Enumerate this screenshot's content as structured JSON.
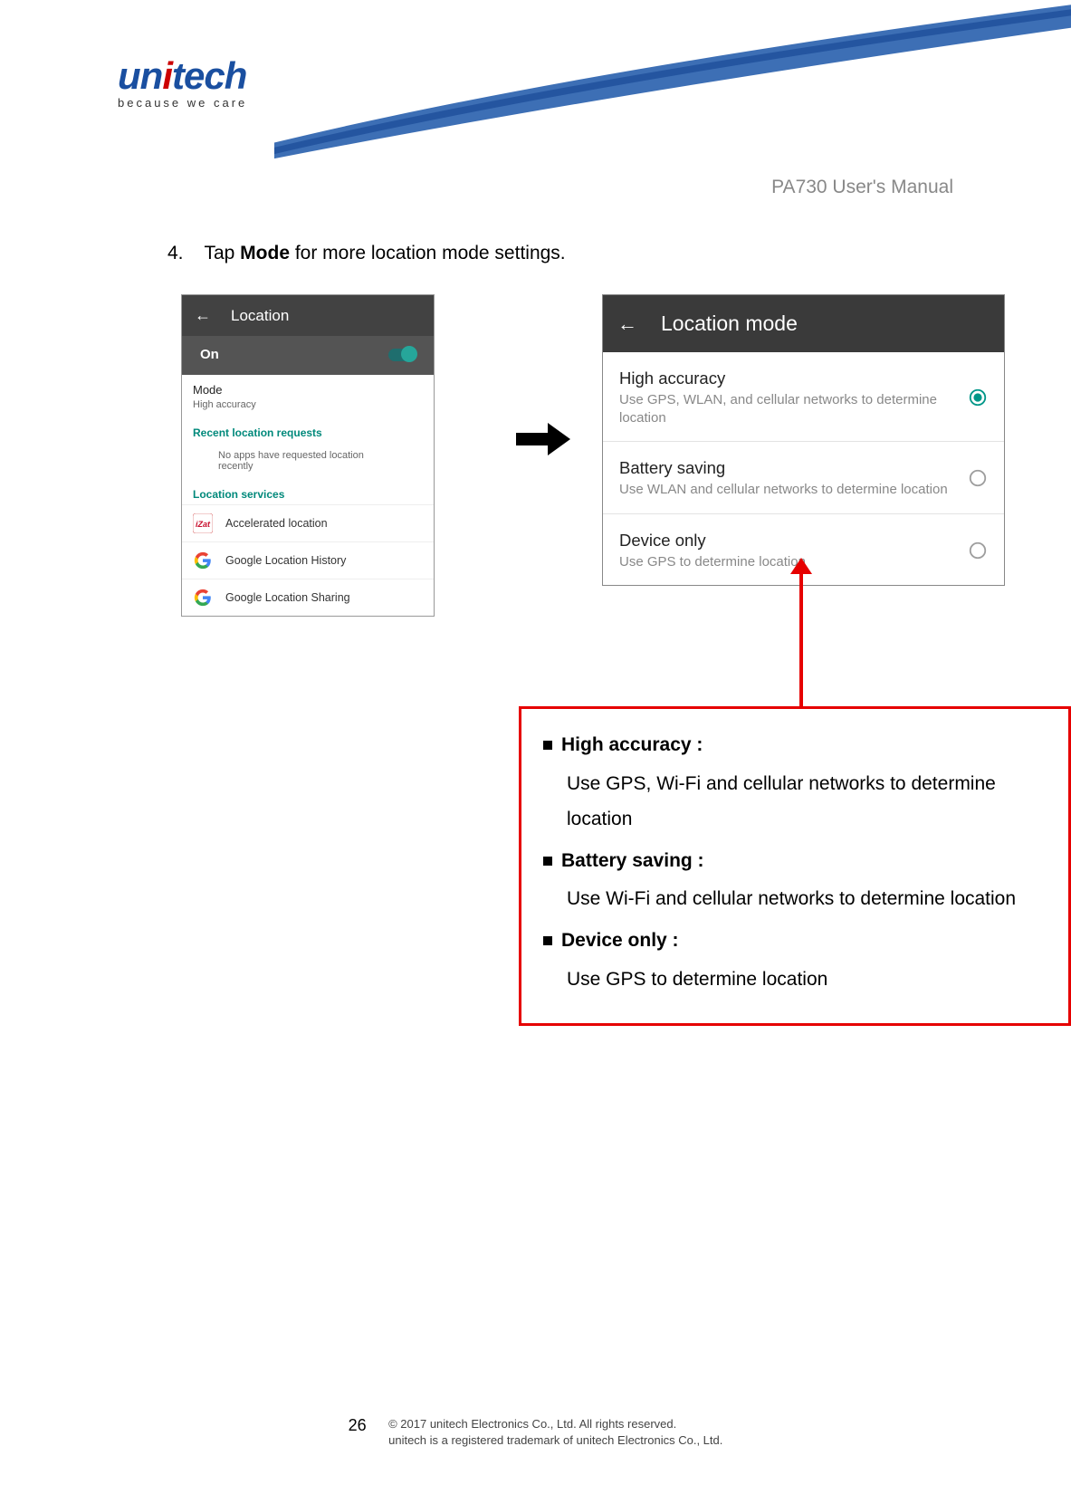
{
  "logo": {
    "brand_pre": "un",
    "brand_post": "tech",
    "tagline": "because we care"
  },
  "doc_title": "PA730 User's Manual",
  "instruction": {
    "number": "4.",
    "pre": "Tap ",
    "bold": "Mode",
    "post": " for more location mode settings."
  },
  "phone1": {
    "title": "Location",
    "on_label": "On",
    "mode_label": "Mode",
    "mode_value": "High accuracy",
    "recent_header": "Recent location requests",
    "recent_info": "No apps have requested location recently",
    "services_header": "Location services",
    "items": [
      {
        "label": "Accelerated location"
      },
      {
        "label": "Google Location History"
      },
      {
        "label": "Google Location Sharing"
      }
    ]
  },
  "phone2": {
    "title": "Location mode",
    "options": [
      {
        "title": "High accuracy",
        "desc": "Use GPS, WLAN, and cellular networks to determine location",
        "selected": true
      },
      {
        "title": "Battery saving",
        "desc": "Use WLAN and cellular networks to determine location",
        "selected": false
      },
      {
        "title": "Device only",
        "desc": "Use GPS to determine location",
        "selected": false
      }
    ]
  },
  "callout": {
    "items": [
      {
        "label": "High accuracy :",
        "desc": "Use GPS, Wi-Fi and cellular networks to determine location"
      },
      {
        "label": "Battery saving :",
        "desc": "Use Wi-Fi and cellular networks to determine location"
      },
      {
        "label": "Device only :",
        "desc": "Use GPS to determine location"
      }
    ]
  },
  "footer": {
    "page": "26",
    "copyright1": "© 2017 unitech Electronics Co., Ltd. All rights reserved.",
    "copyright2": "unitech is a registered trademark of unitech Electronics Co., Ltd."
  }
}
